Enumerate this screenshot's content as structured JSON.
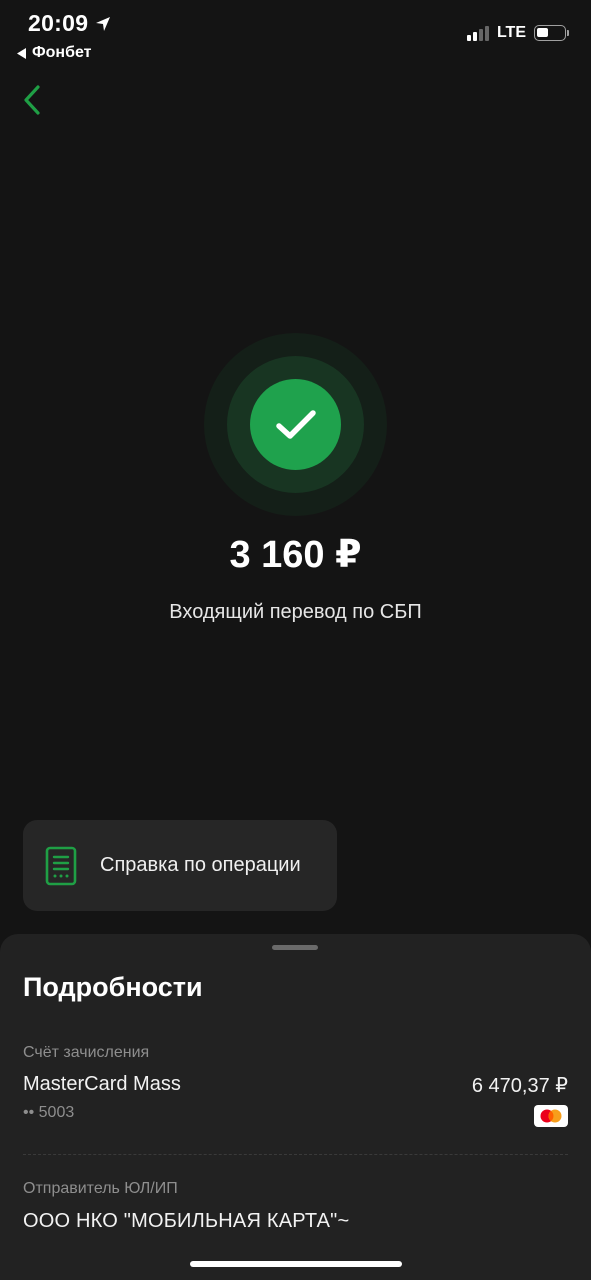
{
  "status_bar": {
    "time": "20:09",
    "back_app": "Фонбет",
    "network": "LTE"
  },
  "transaction": {
    "amount": "3 160 ₽",
    "type": "Входящий перевод по СБП"
  },
  "actions": {
    "receipt_label": "Справка по операции"
  },
  "details": {
    "title": "Подробности",
    "account_label": "Счёт зачисления",
    "account_name": "MasterCard Mass",
    "account_number": "•• 5003",
    "account_balance": "6 470,37 ₽",
    "sender_label": "Отправитель ЮЛ/ИП",
    "sender_value": "ООО НКО \"МОБИЛЬНАЯ КАРТА\"~"
  },
  "colors": {
    "background": "#141414",
    "accent_green": "#1fa24d",
    "sheet": "#222222",
    "button": "#262626"
  },
  "icons": {
    "back": "chevron-left-icon",
    "success": "checkmark-icon",
    "receipt": "document-icon",
    "card_brand": "mastercard-icon",
    "location": "location-arrow-icon"
  }
}
